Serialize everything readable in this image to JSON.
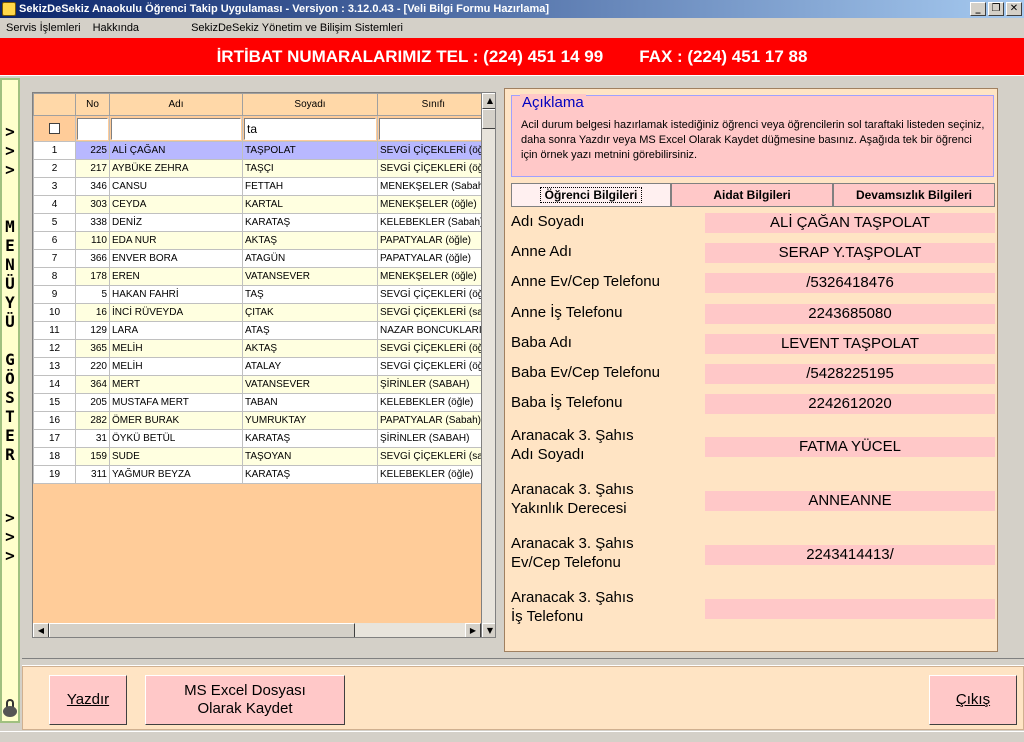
{
  "window": {
    "title": "SekizDeSekiz Anaokulu Öğrenci Takip Uygulaması - Versiyon : 3.12.0.43 - [Veli Bilgi Formu Hazırlama]",
    "buttons": [
      "_",
      "❐",
      "✕"
    ]
  },
  "menubar": {
    "items": [
      "Servis İşlemleri",
      "Hakkında"
    ],
    "extra": "SekizDeSekiz Yönetim ve Bilişim Sistemleri"
  },
  "banner": {
    "tel": "İRTİBAT NUMARALARIMIZ  TEL : (224) 451 14 99",
    "fax": "FAX : (224) 451 17 88"
  },
  "sidestrip": {
    "top_arrows": [
      ">",
      ">",
      ">"
    ],
    "letters": [
      "M",
      "E",
      "N",
      "Ü",
      "Y",
      "Ü",
      "",
      "G",
      "Ö",
      "S",
      "T",
      "E",
      "R"
    ],
    "bottom_arrows": [
      ">",
      ">",
      ">"
    ]
  },
  "grid": {
    "columns": [
      "No",
      "Adı",
      "Soyadı",
      "Sınıfı"
    ],
    "filter": {
      "no": "",
      "adi": "",
      "soyadi": "ta",
      "sinifi": ""
    },
    "rows": [
      {
        "n": "1",
        "no": "225",
        "adi": "ALİ ÇAĞAN",
        "soyadi": "TAŞPOLAT",
        "sinif": "SEVGİ ÇİÇEKLERİ (öğ"
      },
      {
        "n": "2",
        "no": "217",
        "adi": "AYBÜKE ZEHRA",
        "soyadi": "TAŞÇI",
        "sinif": "SEVGİ ÇİÇEKLERİ (öğ"
      },
      {
        "n": "3",
        "no": "346",
        "adi": "CANSU",
        "soyadi": "FETTAH",
        "sinif": "MENEKŞELER (Sabah)"
      },
      {
        "n": "4",
        "no": "303",
        "adi": "CEYDA",
        "soyadi": "KARTAL",
        "sinif": "MENEKŞELER (öğle)"
      },
      {
        "n": "5",
        "no": "338",
        "adi": "DENİZ",
        "soyadi": "KARATAŞ",
        "sinif": "KELEBEKLER (Sabah)"
      },
      {
        "n": "6",
        "no": "110",
        "adi": "EDA NUR",
        "soyadi": "AKTAŞ",
        "sinif": "PAPATYALAR (öğle)"
      },
      {
        "n": "7",
        "no": "366",
        "adi": "ENVER BORA",
        "soyadi": "ATAGÜN",
        "sinif": "PAPATYALAR (öğle)"
      },
      {
        "n": "8",
        "no": "178",
        "adi": "EREN",
        "soyadi": "VATANSEVER",
        "sinif": "MENEKŞELER (öğle)"
      },
      {
        "n": "9",
        "no": "5",
        "adi": "HAKAN FAHRİ",
        "soyadi": "TAŞ",
        "sinif": "SEVGİ ÇİÇEKLERİ (öğ"
      },
      {
        "n": "10",
        "no": "16",
        "adi": "İNCİ RÜVEYDA",
        "soyadi": "ÇITAK",
        "sinif": "SEVGİ ÇİÇEKLERİ (sal"
      },
      {
        "n": "11",
        "no": "129",
        "adi": "LARA",
        "soyadi": "ATAŞ",
        "sinif": "NAZAR BONCUKLARI"
      },
      {
        "n": "12",
        "no": "365",
        "adi": "MELİH",
        "soyadi": "AKTAŞ",
        "sinif": "SEVGİ ÇİÇEKLERİ (öğ"
      },
      {
        "n": "13",
        "no": "220",
        "adi": "MELİH",
        "soyadi": "ATALAY",
        "sinif": "SEVGİ ÇİÇEKLERİ (öğ"
      },
      {
        "n": "14",
        "no": "364",
        "adi": "MERT",
        "soyadi": "VATANSEVER",
        "sinif": "ŞİRİNLER (SABAH)"
      },
      {
        "n": "15",
        "no": "205",
        "adi": "MUSTAFA MERT",
        "soyadi": "TABAN",
        "sinif": "KELEBEKLER (öğle)"
      },
      {
        "n": "16",
        "no": "282",
        "adi": "ÖMER BURAK",
        "soyadi": "YUMRUKTAY",
        "sinif": "PAPATYALAR (Sabah)"
      },
      {
        "n": "17",
        "no": "31",
        "adi": "ÖYKÜ BETÜL",
        "soyadi": "KARATAŞ",
        "sinif": "ŞİRİNLER (SABAH)"
      },
      {
        "n": "18",
        "no": "159",
        "adi": "SUDE",
        "soyadi": "TAŞOYAN",
        "sinif": "SEVGİ ÇİÇEKLERİ (sal"
      },
      {
        "n": "19",
        "no": "311",
        "adi": "YAĞMUR BEYZA",
        "soyadi": "KARATAŞ",
        "sinif": "KELEBEKLER (öğle)"
      }
    ]
  },
  "description": {
    "legend": "Açıklama",
    "text": "Acil durum belgesi hazırlamak istediğiniz öğrenci veya öğrencilerin sol taraftaki listeden seçiniz, daha sonra Yazdır veya MS Excel Olarak Kaydet düğmesine basınız. Aşağıda tek bir öğrenci için örnek yazı metnini görebilirsiniz."
  },
  "tabs": [
    "Öğrenci Bilgileri",
    "Aidat Bilgileri",
    "Devamsızlık Bilgileri"
  ],
  "fields": [
    {
      "label": "Adı Soyadı",
      "label2": "",
      "value": "ALİ ÇAĞAN TAŞPOLAT"
    },
    {
      "label": "Anne Adı",
      "label2": "",
      "value": "SERAP Y.TAŞPOLAT"
    },
    {
      "label": "Anne Ev/Cep Telefonu",
      "label2": "",
      "value": "/5326418476"
    },
    {
      "label": "Anne İş Telefonu",
      "label2": "",
      "value": "2243685080"
    },
    {
      "label": "Baba Adı",
      "label2": "",
      "value": "LEVENT TAŞPOLAT"
    },
    {
      "label": "Baba Ev/Cep Telefonu",
      "label2": "",
      "value": "/5428225195"
    },
    {
      "label": "Baba İş Telefonu",
      "label2": "",
      "value": "2242612020"
    },
    {
      "label": "Aranacak 3. Şahıs",
      "label2": "Adı Soyadı",
      "value": "FATMA YÜCEL"
    },
    {
      "label": "Aranacak 3. Şahıs",
      "label2": "Yakınlık Derecesi",
      "value": "ANNEANNE"
    },
    {
      "label": "Aranacak 3. Şahıs",
      "label2": "Ev/Cep Telefonu",
      "value": "2243414413/"
    },
    {
      "label": "Aranacak 3. Şahıs",
      "label2": "İş Telefonu",
      "value": ""
    }
  ],
  "buttons": {
    "print": "Yazdır",
    "excel_line1": "MS Excel Dosyası",
    "excel_line2": "Olarak Kaydet",
    "exit": "Çıkış"
  }
}
